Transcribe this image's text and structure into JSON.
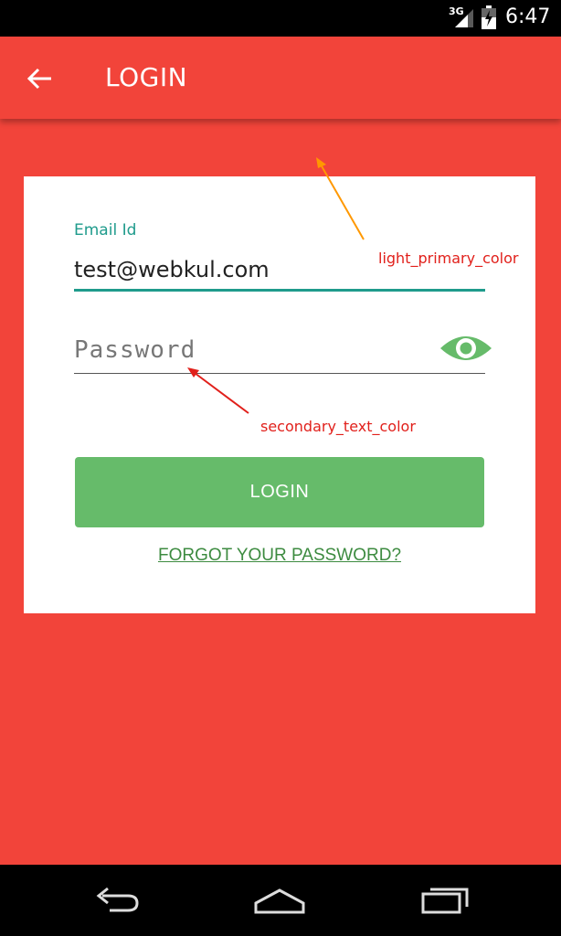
{
  "status_bar": {
    "network": "3G",
    "time": "6:47"
  },
  "app_bar": {
    "title": "LOGIN",
    "back_icon": "arrow-back-icon"
  },
  "form": {
    "email_label": "Email Id",
    "email_value": "test@webkul.com",
    "password_placeholder": "Password",
    "password_value": "",
    "toggle_icon": "eye-icon",
    "login_label": "LOGIN",
    "forgot_label": "FORGOT YOUR PASSWORD?"
  },
  "annotations": {
    "primary": "light_primary_color",
    "secondary": "secondary_text_color"
  },
  "colors": {
    "primary": "#f2443a",
    "accent": "#1f9b8c",
    "button": "#66bb6a",
    "link": "#3d8b40",
    "annotation": "#e1201b",
    "arrow_primary": "#ff9800",
    "arrow_secondary": "#e1201b"
  },
  "nav_bar": {
    "icons": [
      "nav-back-icon",
      "nav-home-icon",
      "nav-recent-apps-icon"
    ]
  }
}
